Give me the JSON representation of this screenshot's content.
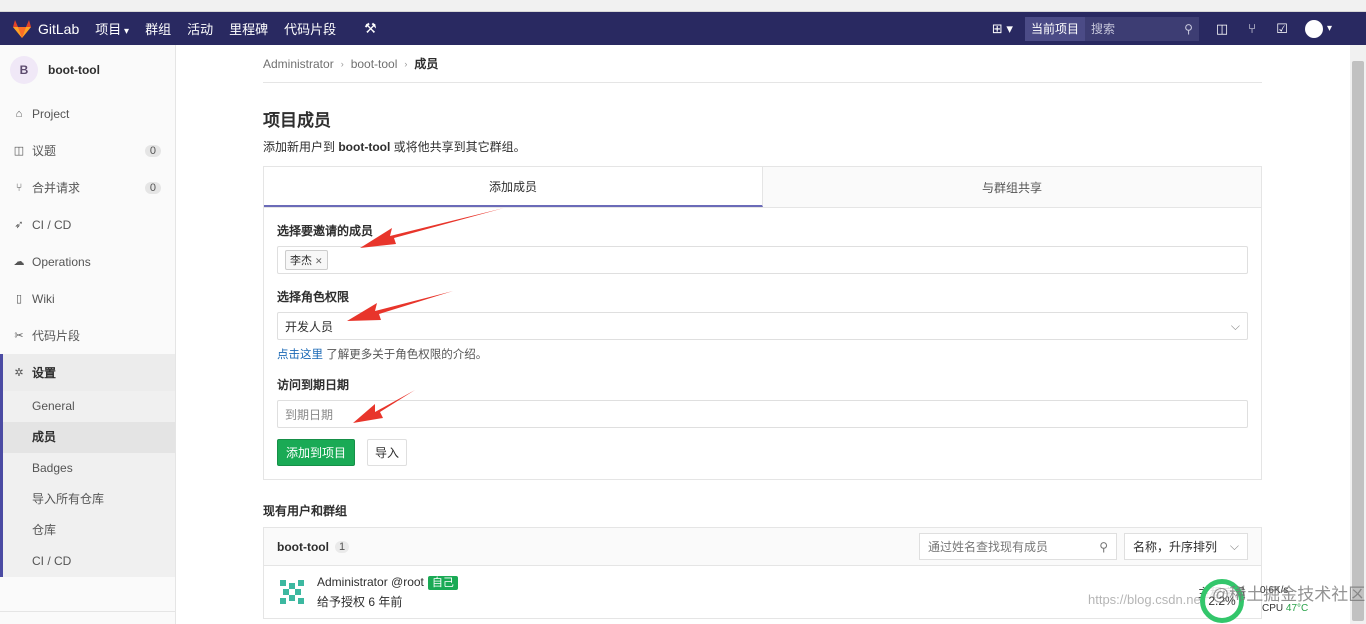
{
  "topnav": {
    "logo_text": "GitLab",
    "items": [
      "项目",
      "群组",
      "活动",
      "里程碑",
      "代码片段"
    ],
    "current_project": "当前项目",
    "search_placeholder": "搜索"
  },
  "sidebar": {
    "avatar_letter": "B",
    "project_name": "boot-tool",
    "items": [
      {
        "label": "Project",
        "icon": "home-icon"
      },
      {
        "label": "议题",
        "icon": "issues-icon",
        "badge": "0"
      },
      {
        "label": "合并请求",
        "icon": "merge-request-icon",
        "badge": "0"
      },
      {
        "label": "CI / CD",
        "icon": "rocket-icon"
      },
      {
        "label": "Operations",
        "icon": "operations-icon"
      },
      {
        "label": "Wiki",
        "icon": "book-icon"
      },
      {
        "label": "代码片段",
        "icon": "scissors-icon"
      },
      {
        "label": "设置",
        "icon": "settings-icon"
      }
    ],
    "settings_sub": [
      "General",
      "成员",
      "Badges",
      "导入所有仓库",
      "仓库",
      "CI / CD"
    ]
  },
  "breadcrumb": [
    "Administrator",
    "boot-tool",
    "成员"
  ],
  "page": {
    "title": "项目成员",
    "desc_prefix": "添加新用户到 ",
    "desc_project": "boot-tool",
    "desc_suffix": " 或将他共享到其它群组。"
  },
  "tabs": [
    "添加成员",
    "与群组共享"
  ],
  "form": {
    "invite_label": "选择要邀请的成员",
    "invite_token": "李杰",
    "role_label": "选择角色权限",
    "role_value": "开发人员",
    "help_link": "点击这里",
    "help_text": " 了解更多关于角色权限的介绍。",
    "expire_label": "访问到期日期",
    "expire_placeholder": "到期日期",
    "add_button": "添加到项目",
    "import_button": "导入"
  },
  "members": {
    "section_title": "现有用户和群组",
    "group_name": "boot-tool",
    "count": "1",
    "search_placeholder": "通过姓名查找现有成员",
    "sort_label": "名称，升序排列",
    "rows": [
      {
        "name": "Administrator @root",
        "self_badge": "自己",
        "granted": "给予授权 6 年前",
        "role": "主程序员"
      }
    ]
  },
  "overlay": {
    "watermark_url": "https://blog.csdn.net/",
    "watermark_brand": "@稀土掘金技术社区",
    "cpu_percent": "2.2%",
    "net_speed": "0.6K/s",
    "cpu_label": "CPU",
    "cpu_temp": "47°C"
  },
  "colors": {
    "topnav": "#292961",
    "primary": "#1aaa55",
    "annotation_arrow": "#e8352b"
  }
}
